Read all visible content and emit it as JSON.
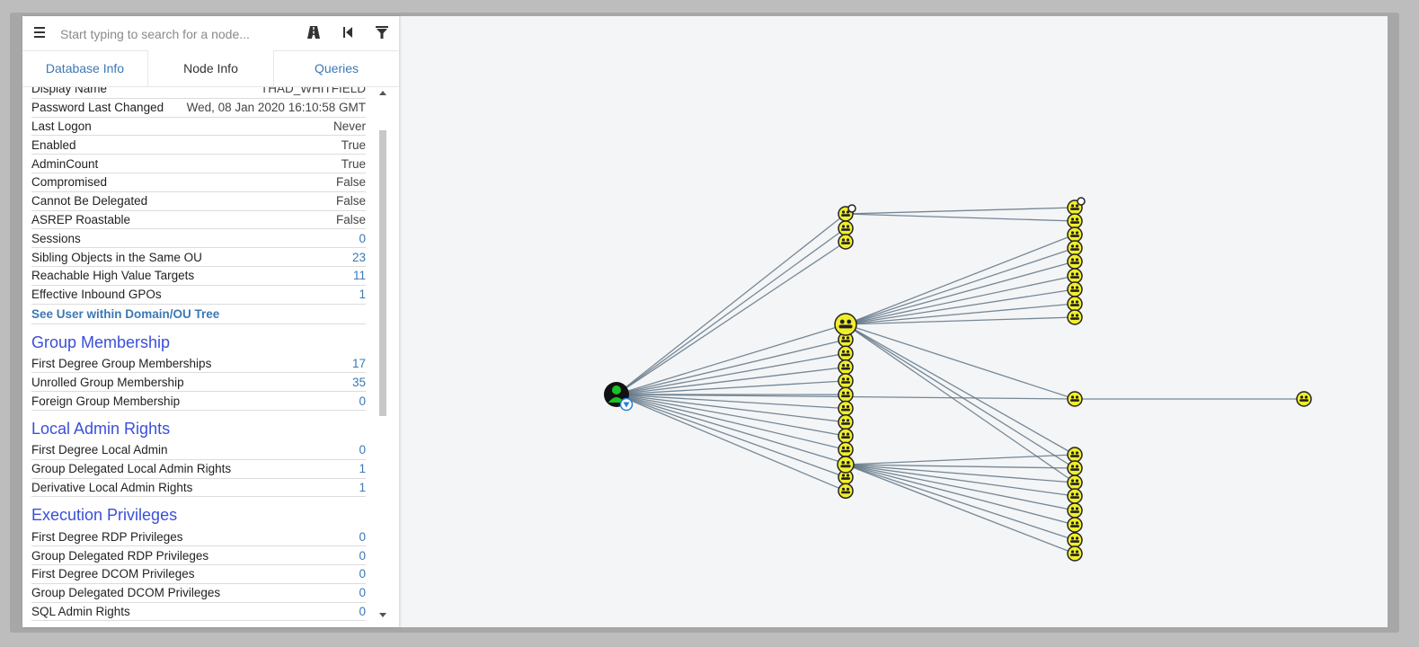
{
  "search": {
    "placeholder": "Start typing to search for a node..."
  },
  "icons": {
    "menu": "hamburger-menu-icon",
    "pathfinding": "road-path-icon",
    "back": "back-skip-icon",
    "filter": "filter-funnel-icon"
  },
  "tabs": [
    {
      "label": "Database Info"
    },
    {
      "label": "Node Info"
    },
    {
      "label": "Queries"
    }
  ],
  "node_info": {
    "rows": [
      {
        "label": "Display Name",
        "value": "THAD_WHITFIELD"
      },
      {
        "label": "Password Last Changed",
        "value": "Wed, 08 Jan 2020 16:10:58 GMT"
      },
      {
        "label": "Last Logon",
        "value": "Never"
      },
      {
        "label": "Enabled",
        "value": "True"
      },
      {
        "label": "AdminCount",
        "value": "True"
      },
      {
        "label": "Compromised",
        "value": "False"
      },
      {
        "label": "Cannot Be Delegated",
        "value": "False"
      },
      {
        "label": "ASREP Roastable",
        "value": "False"
      },
      {
        "label": "Sessions",
        "value": "0"
      },
      {
        "label": "Sibling Objects in the Same OU",
        "value": "23"
      },
      {
        "label": "Reachable High Value Targets",
        "value": "11"
      },
      {
        "label": "Effective Inbound GPOs",
        "value": "1"
      }
    ],
    "ou_link": "See User within Domain/OU Tree",
    "group_membership": {
      "title": "Group Membership",
      "rows": [
        {
          "label": "First Degree Group Memberships",
          "value": "17"
        },
        {
          "label": "Unrolled Group Membership",
          "value": "35"
        },
        {
          "label": "Foreign Group Membership",
          "value": "0"
        }
      ]
    },
    "local_admin": {
      "title": "Local Admin Rights",
      "rows": [
        {
          "label": "First Degree Local Admin",
          "value": "0"
        },
        {
          "label": "Group Delegated Local Admin Rights",
          "value": "1"
        },
        {
          "label": "Derivative Local Admin Rights",
          "value": "1"
        }
      ]
    },
    "execution": {
      "title": "Execution Privileges",
      "rows": [
        {
          "label": "First Degree RDP Privileges",
          "value": "0"
        },
        {
          "label": "Group Delegated RDP Privileges",
          "value": "0"
        },
        {
          "label": "First Degree DCOM Privileges",
          "value": "0"
        },
        {
          "label": "Group Delegated DCOM Privileges",
          "value": "0"
        },
        {
          "label": "SQL Admin Rights",
          "value": "0"
        }
      ]
    }
  },
  "colors": {
    "link": "#3c78b4",
    "section": "#3a4fd8",
    "group_node": "#f0ee2a",
    "user_node": "#17c424",
    "edge": "#5f7384"
  }
}
